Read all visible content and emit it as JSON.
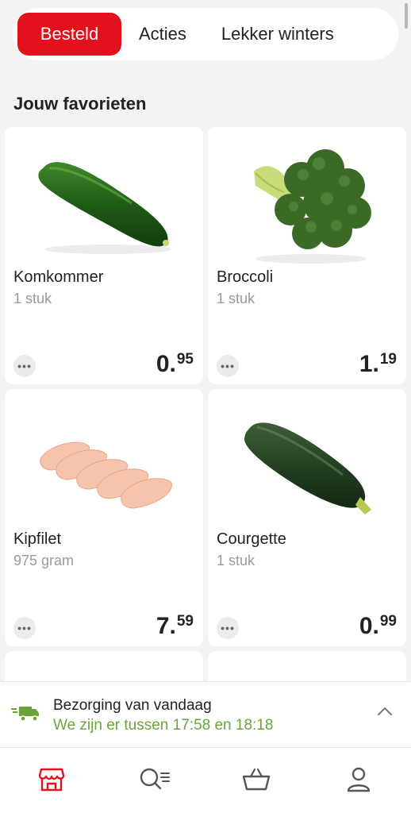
{
  "tabs": [
    {
      "label": "Besteld",
      "active": true
    },
    {
      "label": "Acties",
      "active": false
    },
    {
      "label": "Lekker winters",
      "active": false
    }
  ],
  "section": {
    "title": "Jouw favorieten"
  },
  "products": [
    {
      "name": "Komkommer",
      "unit": "1 stuk",
      "price_main": "0.",
      "price_cents": "95",
      "image": "cucumber"
    },
    {
      "name": "Broccoli",
      "unit": "1 stuk",
      "price_main": "1.",
      "price_cents": "19",
      "image": "broccoli"
    },
    {
      "name": "Kipfilet",
      "unit": "975 gram",
      "price_main": "7.",
      "price_cents": "59",
      "image": "chicken-breast"
    },
    {
      "name": "Courgette",
      "unit": "1 stuk",
      "price_main": "0.",
      "price_cents": "99",
      "image": "zucchini"
    }
  ],
  "more_label": "•••",
  "delivery": {
    "title": "Bezorging van vandaag",
    "time": "We zijn er tussen 17:58 en 18:18"
  },
  "nav": [
    {
      "icon": "store-icon",
      "active": true
    },
    {
      "icon": "search-list-icon",
      "active": false
    },
    {
      "icon": "basket-icon",
      "active": false
    },
    {
      "icon": "profile-icon",
      "active": false
    }
  ],
  "colors": {
    "accent": "#e3111c",
    "delivery_green": "#6aa53a"
  }
}
